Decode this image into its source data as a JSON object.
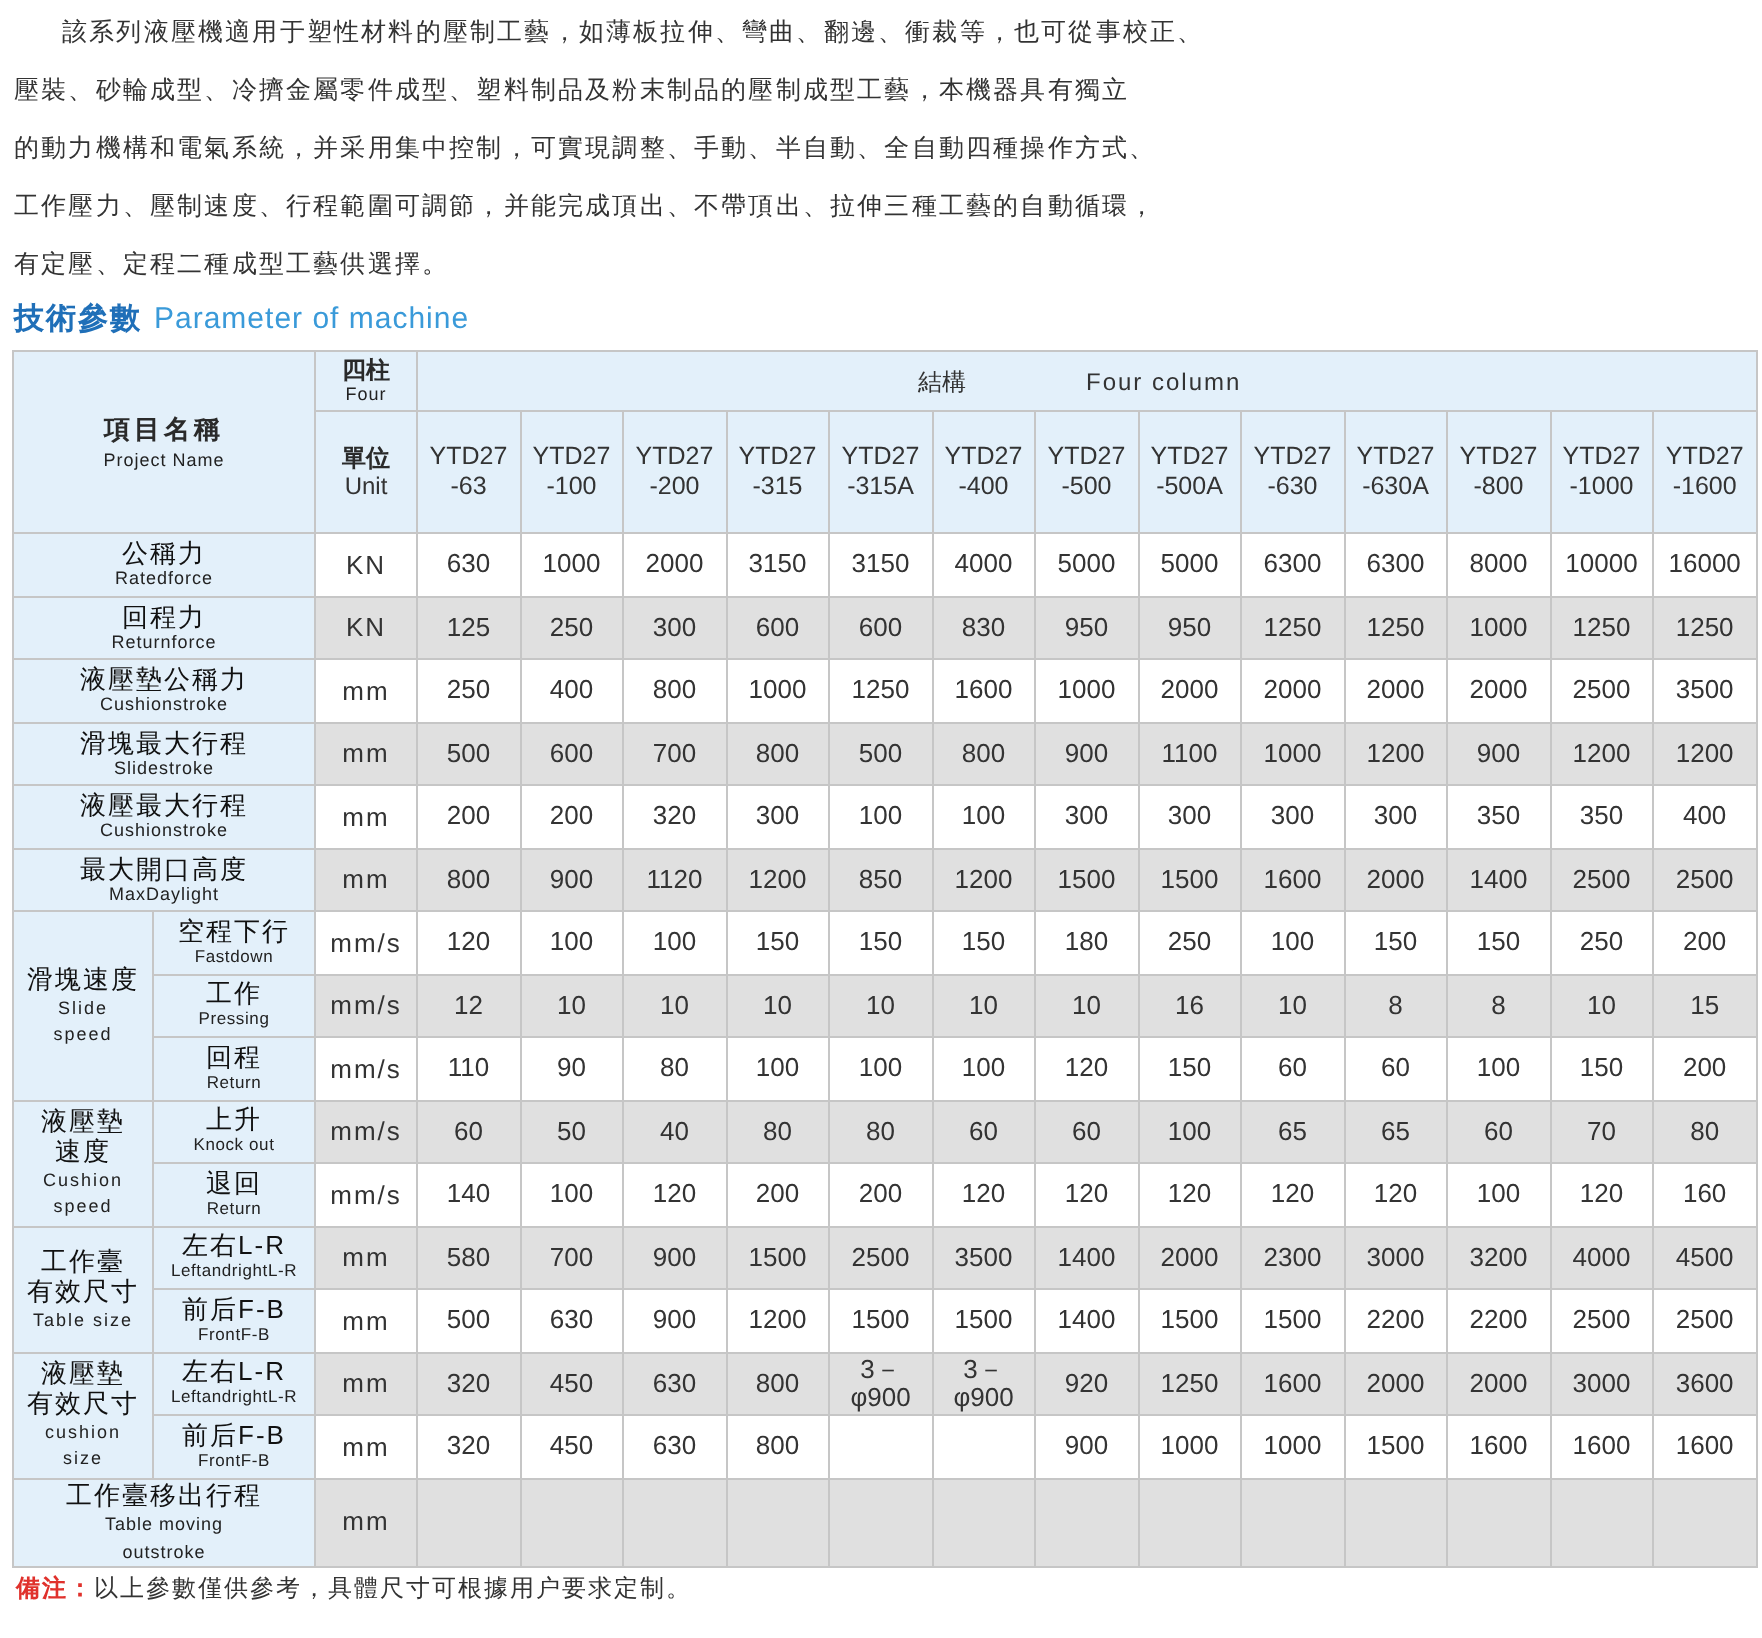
{
  "intro": {
    "lines": [
      "該系列液壓機適用于塑性材料的壓制工藝，如薄板拉伸、彎曲、翻邊、衝裁等，也可從事校正、",
      "壓裝、砂輪成型、冷擠金屬零件成型、塑料制品及粉末制品的壓制成型工藝，本機器具有獨立",
      "的動力機構和電氣系統，并采用集中控制，可實現調整、手動、半自動、全自動四種操作方式、",
      "工作壓力、壓制速度、行程範圍可調節，并能完成頂出、不帶頂出、拉伸三種工藝的自動循環，",
      "有定壓、定程二種成型工藝供選擇。"
    ]
  },
  "section_title": {
    "zh": "技術參數",
    "en": "Parameter of machine"
  },
  "table": {
    "corner": {
      "zh": "項目名稱",
      "en": "Project Name"
    },
    "structure": {
      "zh": "四柱",
      "en": "Four"
    },
    "structure_span": {
      "zh": "結構",
      "en": "Four column"
    },
    "unit_header": {
      "zh": "單位",
      "en": "Unit"
    },
    "models": [
      "YTD27\n-63",
      "YTD27\n-100",
      "YTD27\n-200",
      "YTD27\n-315",
      "YTD27\n-315A",
      "YTD27\n-400",
      "YTD27\n-500",
      "YTD27\n-500A",
      "YTD27\n-630",
      "YTD27\n-630A",
      "YTD27\n-800",
      "YTD27\n-1000",
      "YTD27\n-1600"
    ],
    "rows": [
      {
        "kind": "single",
        "zh": "公稱力",
        "en": "Ratedforce",
        "unit": "KN",
        "values": [
          "630",
          "1000",
          "2000",
          "3150",
          "3150",
          "4000",
          "5000",
          "5000",
          "6300",
          "6300",
          "8000",
          "10000",
          "16000"
        ]
      },
      {
        "kind": "single",
        "zh": "回程力",
        "en": "Returnforce",
        "unit": "KN",
        "values": [
          "125",
          "250",
          "300",
          "600",
          "600",
          "830",
          "950",
          "950",
          "1250",
          "1250",
          "1000",
          "1250",
          "1250"
        ]
      },
      {
        "kind": "single",
        "zh": "液壓墊公稱力",
        "en": "Cushionstroke",
        "unit": "mm",
        "values": [
          "250",
          "400",
          "800",
          "1000",
          "1250",
          "1600",
          "1000",
          "2000",
          "2000",
          "2000",
          "2000",
          "2500",
          "3500"
        ]
      },
      {
        "kind": "single",
        "zh": "滑塊最大行程",
        "en": "Slidestroke",
        "unit": "mm",
        "values": [
          "500",
          "600",
          "700",
          "800",
          "500",
          "800",
          "900",
          "1100",
          "1000",
          "1200",
          "900",
          "1200",
          "1200"
        ]
      },
      {
        "kind": "single",
        "zh": "液壓最大行程",
        "en": "Cushionstroke",
        "unit": "mm",
        "values": [
          "200",
          "200",
          "320",
          "300",
          "100",
          "100",
          "300",
          "300",
          "300",
          "300",
          "350",
          "350",
          "400"
        ]
      },
      {
        "kind": "single",
        "zh": "最大開口高度",
        "en": "MaxDaylight",
        "unit": "mm",
        "values": [
          "800",
          "900",
          "1120",
          "1200",
          "850",
          "1200",
          "1500",
          "1500",
          "1600",
          "2000",
          "1400",
          "2500",
          "2500"
        ]
      },
      {
        "kind": "group",
        "zh": [
          "滑塊速度"
        ],
        "en": "Slide\nspeed",
        "children": [
          {
            "zh": "空程下行",
            "en": "Fastdown",
            "unit": "mm/s",
            "values": [
              "120",
              "100",
              "100",
              "150",
              "150",
              "150",
              "180",
              "250",
              "100",
              "150",
              "150",
              "250",
              "200"
            ]
          },
          {
            "zh": "工作",
            "en": "Pressing",
            "unit": "mm/s",
            "values": [
              "12",
              "10",
              "10",
              "10",
              "10",
              "10",
              "10",
              "16",
              "10",
              "8",
              "8",
              "10",
              "15"
            ]
          },
          {
            "zh": "回程",
            "en": "Return",
            "unit": "mm/s",
            "values": [
              "110",
              "90",
              "80",
              "100",
              "100",
              "100",
              "120",
              "150",
              "60",
              "60",
              "100",
              "150",
              "200"
            ]
          }
        ]
      },
      {
        "kind": "group",
        "zh": [
          "液壓墊",
          "速度"
        ],
        "en": "Cushion\nspeed",
        "children": [
          {
            "zh": "上升",
            "en": "Knock out",
            "unit": "mm/s",
            "values": [
              "60",
              "50",
              "40",
              "80",
              "80",
              "60",
              "60",
              "100",
              "65",
              "65",
              "60",
              "70",
              "80"
            ]
          },
          {
            "zh": "退回",
            "en": "Return",
            "unit": "mm/s",
            "values": [
              "140",
              "100",
              "120",
              "200",
              "200",
              "120",
              "120",
              "120",
              "120",
              "120",
              "100",
              "120",
              "160"
            ]
          }
        ]
      },
      {
        "kind": "group",
        "zh": [
          "工作臺",
          "有效尺寸"
        ],
        "en": "Table size",
        "children": [
          {
            "zh": "左右L-R",
            "en": "LeftandrightL-R",
            "unit": "mm",
            "values": [
              "580",
              "700",
              "900",
              "1500",
              "2500",
              "3500",
              "1400",
              "2000",
              "2300",
              "3000",
              "3200",
              "4000",
              "4500"
            ]
          },
          {
            "zh": "前后F-B",
            "en": "FrontF-B",
            "unit": "mm",
            "values": [
              "500",
              "630",
              "900",
              "1200",
              "1500",
              "1500",
              "1400",
              "1500",
              "1500",
              "2200",
              "2200",
              "2500",
              "2500"
            ]
          }
        ]
      },
      {
        "kind": "group",
        "zh": [
          "液壓墊",
          "有效尺寸"
        ],
        "en": "cushion\nsize",
        "children": [
          {
            "zh": "左右L-R",
            "en": "LeftandrightL-R",
            "unit": "mm",
            "values": [
              "320",
              "450",
              "630",
              "800",
              "3－\nφ900",
              "3－\nφ900",
              "920",
              "1250",
              "1600",
              "2000",
              "2000",
              "3000",
              "3600"
            ]
          },
          {
            "zh": "前后F-B",
            "en": "FrontF-B",
            "unit": "mm",
            "cells": [
              {
                "kind": "value",
                "text": "320"
              },
              {
                "kind": "value",
                "text": "450"
              },
              {
                "kind": "value",
                "text": "630"
              },
              {
                "kind": "value",
                "text": "800"
              },
              {
                "kind": "blank"
              },
              {
                "kind": "blank"
              },
              {
                "kind": "value",
                "text": "900"
              },
              {
                "kind": "value",
                "text": "1000"
              },
              {
                "kind": "value",
                "text": "1000"
              },
              {
                "kind": "value",
                "text": "1500"
              },
              {
                "kind": "value",
                "text": "1600"
              },
              {
                "kind": "value",
                "text": "1600"
              },
              {
                "kind": "value",
                "text": "1600"
              }
            ]
          }
        ]
      },
      {
        "kind": "single",
        "zh": "工作臺移出行程",
        "en": "Table moving\noutstroke",
        "unit": "mm"
      }
    ]
  },
  "note": {
    "label": "備注：",
    "text": "以上參數僅供參考，具體尺寸可根據用户要求定制。"
  }
}
